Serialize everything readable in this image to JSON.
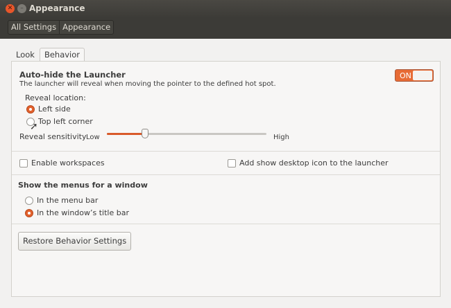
{
  "window": {
    "title": "Appearance"
  },
  "breadcrumb": [
    "All Settings",
    "Appearance"
  ],
  "tabs": [
    {
      "label": "Look",
      "active": false
    },
    {
      "label": "Behavior",
      "active": true
    }
  ],
  "autohide": {
    "title": "Auto-hide the Launcher",
    "description": "The launcher will reveal when moving the pointer to the defined hot spot.",
    "toggle": "ON",
    "reveal_location_label": "Reveal location:",
    "options": [
      {
        "label": "Left side",
        "selected": true
      },
      {
        "label": "Top left corner",
        "selected": false
      }
    ],
    "sensitivity_label": "Reveal sensitivity",
    "low": "Low",
    "high": "High",
    "sensitivity_value": 0.24
  },
  "checkboxes": {
    "workspaces": "Enable workspaces",
    "desktop_icon": "Add show desktop icon to the launcher"
  },
  "menus": {
    "title": "Show the menus for a window",
    "options": [
      {
        "label": "In the menu bar",
        "selected": false
      },
      {
        "label": "In the window’s title bar",
        "selected": true
      }
    ]
  },
  "restore_button": "Restore Behavior Settings",
  "colors": {
    "accent": "#e2612c",
    "titlebar": "#3c3b37"
  }
}
